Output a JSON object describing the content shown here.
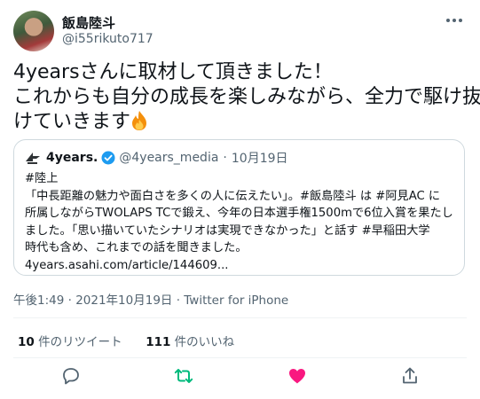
{
  "author": {
    "display_name": "飯島陸斗",
    "handle": "@i55rikuto717"
  },
  "tweet": {
    "lines": [
      "4yearsさんに取材して頂きました！",
      "これからも自分の成長を楽しみながら、全力で駆け抜",
      "けていきます"
    ]
  },
  "quoted": {
    "name": "4years.",
    "handle": "@4years_media",
    "separator": "·",
    "date": "10月19日",
    "lines": [
      "#陸上",
      "「中長距離の魅力や面白さを多くの人に伝えたい」。#飯島陸斗 は #阿見AC に",
      "所属しながらTWOLAPS TCで鍛え、今年の日本選手権1500mで6位入賞を果たし",
      "ました。「思い描いていたシナリオは実現できなかった」と話す #早稲田大学",
      "時代も含め、これまでの話を聞きました。",
      "4years.asahi.com/article/144609..."
    ]
  },
  "meta": {
    "time": "午後1:49 · 2021年10月19日 · Twitter for iPhone"
  },
  "stats": {
    "retweets_count": "10",
    "retweets_label": " 件のリツイート",
    "likes_count": "111",
    "likes_label": " 件のいいね"
  },
  "icons": {
    "reply": "reply-icon",
    "retweet": "retweet-icon",
    "like": "heart-icon",
    "share": "share-icon"
  },
  "colors": {
    "retweet_active": "#00ba7c",
    "like_active": "#f91880",
    "verified": "#1d9bf0",
    "secondary_text": "#536471"
  }
}
